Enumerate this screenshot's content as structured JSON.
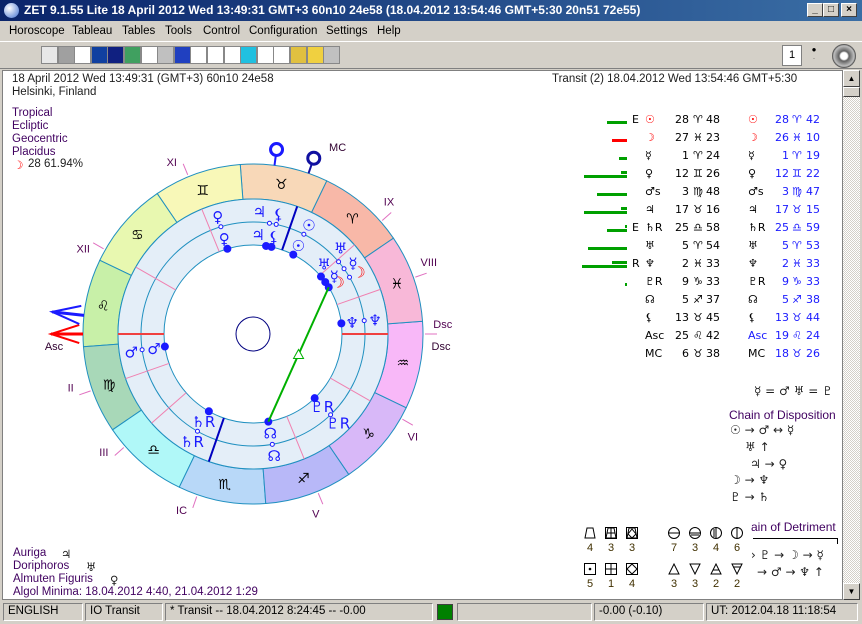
{
  "window": {
    "title": "ZET 9.1.55 Lite   18 April 2012   Wed   13:49:31 GMT+3 60n10   24e58   (18.04.2012   13:54:46 GMT+5:30  20n51  72e55)",
    "min": "_",
    "max": "□",
    "close": "×"
  },
  "menu": [
    "Horoscope",
    "Tableau",
    "Tables",
    "Tools",
    "Control",
    "Configuration",
    "Settings",
    "Help"
  ],
  "toolbar": {
    "icons": [
      "calendar-grid-icon",
      "globe-icon",
      "wheel-icon",
      "star-map-icon",
      "night-sky-icon",
      "map-icon",
      "g-icon",
      "documents-icon",
      "book-icon",
      "list-icon",
      "table-icon",
      "graph-icon",
      "arrow-chart-icon",
      "notes-icon",
      "target-icon",
      "tools-icon",
      "alarm-icon",
      "figure-icon"
    ],
    "colors": [
      "#e8e8e8",
      "#a0a0a0",
      "#ffffff",
      "#1040a0",
      "#102080",
      "#40a060",
      "#ffffff",
      "#c0c0c0",
      "#2040c0",
      "#ffffff",
      "#ffffff",
      "#ffffff",
      "#20c0e0",
      "#ffffff",
      "#ffffff",
      "#e0c040",
      "#f0d040",
      "#c0c0c0"
    ],
    "spin_value": "1"
  },
  "header": {
    "left_line1": "18 April 2012   Wed   13:49:31 (GMT+3) 60n10   24e58",
    "left_line2": "Helsinki, Finland",
    "right_line1": "Transit (2) 18.04.2012   Wed 13:54:46 GMT+5:30"
  },
  "settings": [
    "Tropical",
    "Ecliptic",
    "Geocentric",
    "Placidus"
  ],
  "moon_phase": {
    "glyph": "☽",
    "text": "28 61.94%"
  },
  "colors": {
    "natal": "#000000",
    "transit": "#1a1aff",
    "moon": "#ff0000",
    "aspect_trine": "#00b000",
    "bar": "#00a000",
    "bar_red": "#ff0000"
  },
  "chart": {
    "sign_glyphs": [
      "♈",
      "♉",
      "♊",
      "♋",
      "♌",
      "♍",
      "♎",
      "♏",
      "♐",
      "♑",
      "♒",
      "♓"
    ],
    "sign_colors": [
      "#f8b8a8",
      "#f8d8b8",
      "#f8f8b8",
      "#e8f8b0",
      "#c8f0a8",
      "#a8d8b8",
      "#b0f8f8",
      "#b8d8f8",
      "#b8b8f8",
      "#d8b8f8",
      "#f8b8f8",
      "#f8b8d8"
    ],
    "ascendant": 145.7,
    "mc": 36.63,
    "transit_asc": 139.4,
    "transit_mc": 48.43,
    "house_cusps": [
      145.7,
      165,
      187,
      216.6,
      258,
      296,
      325.7,
      345,
      7,
      36.6,
      78,
      116
    ],
    "house_labels": [
      "Asc",
      "II",
      "III",
      "IC",
      "V",
      "VI",
      "Dsc",
      "VIII",
      "IX",
      "MC",
      "XI",
      "XII"
    ],
    "natal": [
      {
        "g": "☉",
        "lon": 28.8
      },
      {
        "g": "☽",
        "lon": 357.38
      },
      {
        "g": "☿",
        "lon": 1.4
      },
      {
        "g": "♀",
        "lon": 72.43
      },
      {
        "g": "♂",
        "lon": 153.8
      },
      {
        "g": "♃",
        "lon": 47.27
      },
      {
        "g": "♄R",
        "lon": 205.97
      },
      {
        "g": "♅",
        "lon": 5.9
      },
      {
        "g": "♆",
        "lon": 332.55
      },
      {
        "g": "♇R",
        "lon": 279.55
      },
      {
        "g": "☊",
        "lon": 245.62
      },
      {
        "g": "⚸",
        "lon": 43.75
      }
    ],
    "transit": [
      {
        "g": "☉",
        "lon": 28.7
      },
      {
        "g": "☽",
        "lon": 356.17
      },
      {
        "g": "☿",
        "lon": 1.32
      },
      {
        "g": "♀",
        "lon": 72.37
      },
      {
        "g": "♂",
        "lon": 153.78
      },
      {
        "g": "♃",
        "lon": 47.25
      },
      {
        "g": "♄R",
        "lon": 205.98
      },
      {
        "g": "♅",
        "lon": 5.88
      },
      {
        "g": "♆",
        "lon": 332.55
      },
      {
        "g": "♇R",
        "lon": 279.55
      },
      {
        "g": "☊",
        "lon": 245.63
      },
      {
        "g": "⚸",
        "lon": 43.73
      }
    ],
    "aspects": [
      {
        "from": 357.38,
        "to": 245.62,
        "type": "trine"
      }
    ]
  },
  "positions": [
    {
      "mark": "E",
      "g": "☉",
      "deg": "28",
      "sign": "♈",
      "min": "48",
      "tg": "☉",
      "tdeg": "28",
      "tsign": "♈",
      "tmin": "42",
      "bar": 20,
      "bar2": 0,
      "red": true
    },
    {
      "mark": "",
      "g": "☽",
      "deg": "27",
      "sign": "♓",
      "min": "23",
      "tg": "☽",
      "tdeg": "26",
      "tsign": "♓",
      "tmin": "10",
      "bar": 15,
      "bar2": 0,
      "red": true
    },
    {
      "mark": "",
      "g": "☿",
      "deg": "1",
      "sign": "♈",
      "min": "24",
      "tg": "☿",
      "tdeg": "1",
      "tsign": "♈",
      "tmin": "19",
      "bar": 8,
      "bar2": 0
    },
    {
      "mark": "",
      "g": "♀",
      "deg": "12",
      "sign": "♊",
      "min": "26",
      "tg": "♀",
      "tdeg": "12",
      "tsign": "♊",
      "tmin": "22",
      "bar": 43,
      "bar2": 6
    },
    {
      "mark": "",
      "g": "♂s",
      "deg": "3",
      "sign": "♍",
      "min": "48",
      "tg": "♂s",
      "tdeg": "3",
      "tsign": "♍",
      "tmin": "47",
      "bar": 30,
      "bar2": 0
    },
    {
      "mark": "",
      "g": "♃",
      "deg": "17",
      "sign": "♉",
      "min": "16",
      "tg": "♃",
      "tdeg": "17",
      "tsign": "♉",
      "tmin": "15",
      "bar": 43,
      "bar2": 6
    },
    {
      "mark": "E",
      "g": "♄R",
      "deg": "25",
      "sign": "♎",
      "min": "58",
      "tg": "♄R",
      "tdeg": "25",
      "tsign": "♎",
      "tmin": "59",
      "bar": 20,
      "bar2": 2
    },
    {
      "mark": "",
      "g": "♅",
      "deg": "5",
      "sign": "♈",
      "min": "54",
      "tg": "♅",
      "tdeg": "5",
      "tsign": "♈",
      "tmin": "53",
      "bar": 39,
      "bar2": 0
    },
    {
      "mark": "R",
      "g": "♆",
      "deg": "2",
      "sign": "♓",
      "min": "33",
      "tg": "♆",
      "tdeg": "2",
      "tsign": "♓",
      "tmin": "33",
      "bar": 45,
      "bar2": 15
    },
    {
      "mark": "",
      "g": "♇R",
      "deg": "9",
      "sign": "♑",
      "min": "33",
      "tg": "♇R",
      "tdeg": "9",
      "tsign": "♑",
      "tmin": "33",
      "bar": 2,
      "bar2": 0
    },
    {
      "mark": "",
      "g": "☊",
      "deg": "5",
      "sign": "♐",
      "min": "37",
      "tg": "☊",
      "tdeg": "5",
      "tsign": "♐",
      "tmin": "38",
      "bar": 0,
      "bar2": 0
    },
    {
      "mark": "",
      "g": "⚸",
      "deg": "13",
      "sign": "♉",
      "min": "45",
      "tg": "⚸",
      "tdeg": "13",
      "tsign": "♉",
      "tmin": "44",
      "bar": 0,
      "bar2": 0
    },
    {
      "mark": "",
      "g": "Asc",
      "deg": "25",
      "sign": "♌",
      "min": "42",
      "tg": "Asc",
      "tdeg": "19",
      "tsign": "♌",
      "tmin": "24",
      "bar": 0,
      "bar2": 0
    },
    {
      "mark": "",
      "g": "MC",
      "deg": "6",
      "sign": "♉",
      "min": "38",
      "tg": "MC",
      "tdeg": "18",
      "tsign": "♉",
      "tmin": "26",
      "bar": 0,
      "bar2": 0
    }
  ],
  "receptions": "☿ = ♂ ♅ = ♇",
  "disposition": {
    "title": "Chain of Disposition",
    "rows": [
      "☉ → ♂ ↔ ☿",
      "♅ ↑",
      "♃ → ♀",
      "☽ → ♆",
      "♇ → ♄"
    ]
  },
  "detriment": {
    "title": "ain of Detriment",
    "rows": [
      "› ♇ → ☽ → ☿",
      "→ ♂ → ♆ ↑"
    ]
  },
  "patterns": [
    {
      "icon": "trapezoid",
      "n": "4"
    },
    {
      "icon": "box-cross-top",
      "n": "3"
    },
    {
      "icon": "box-diamond-top",
      "n": "3"
    },
    {
      "icon": "circle-hline",
      "n": "7"
    },
    {
      "icon": "circle-bottom",
      "n": "3"
    },
    {
      "icon": "circle-left",
      "n": "4"
    },
    {
      "icon": "circle-right",
      "n": "6"
    },
    {
      "icon": "box-dot",
      "n": "5"
    },
    {
      "icon": "box-cross",
      "n": "1"
    },
    {
      "icon": "box-diamond",
      "n": "4"
    },
    {
      "icon": "triangle-up",
      "n": "3"
    },
    {
      "icon": "triangle-down",
      "n": "3"
    },
    {
      "icon": "triangle-up-bar",
      "n": "2"
    },
    {
      "icon": "triangle-down-bar",
      "n": "2"
    }
  ],
  "rulers": [
    {
      "label": "Auriga",
      "g": "♃"
    },
    {
      "label": "Doriphoros",
      "g": "♅"
    },
    {
      "label": "Almuten Figuris",
      "g": "♀"
    }
  ],
  "algol": "Algol Minima: 18.04.2012  4:40,  21.04.2012  1:29",
  "status": {
    "language": "ENGLISH",
    "mode": "IO Transit",
    "transit": "*  Transit -- 18.04.2012  8:24:45 -- -0.00",
    "offset": "-0.00 (-0.10)",
    "ut": "UT: 2012.04.18 11:18:54"
  }
}
